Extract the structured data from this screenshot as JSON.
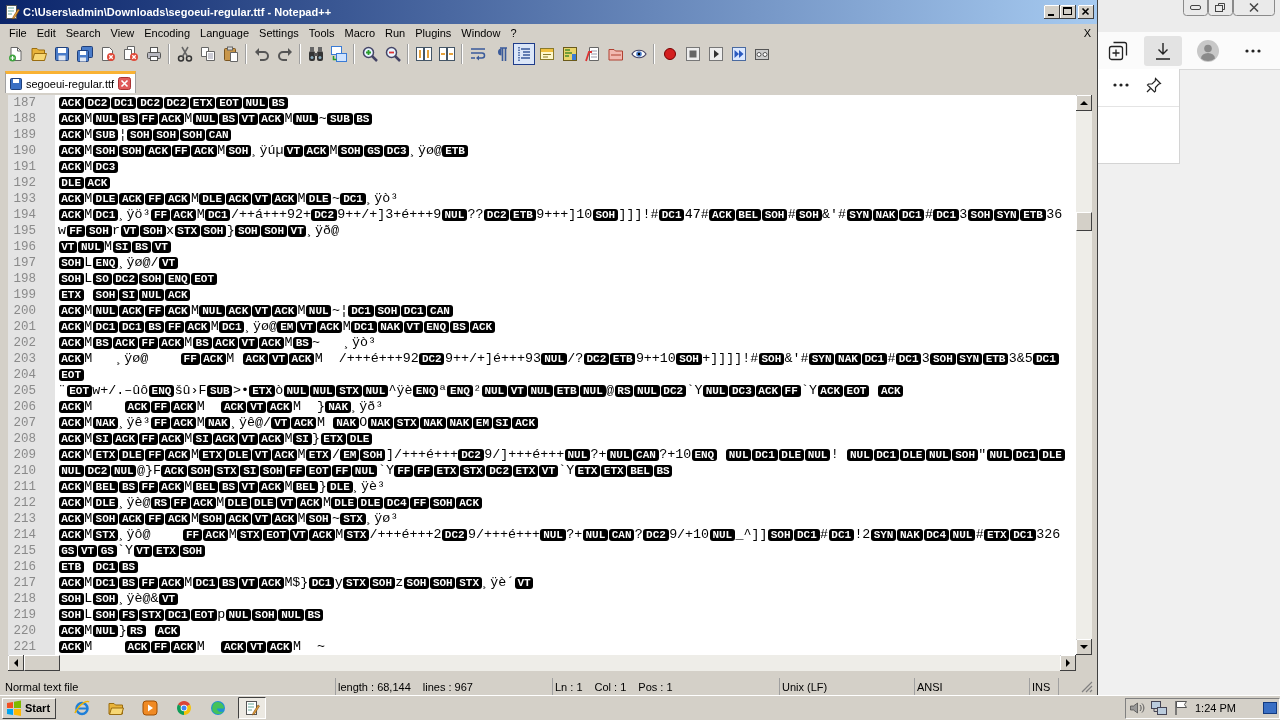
{
  "window": {
    "title": "C:\\Users\\admin\\Downloads\\segoeui-regular.ttf - Notepad++"
  },
  "menu": {
    "items": [
      "File",
      "Edit",
      "Search",
      "View",
      "Encoding",
      "Language",
      "Settings",
      "Tools",
      "Macro",
      "Run",
      "Plugins",
      "Window",
      "?"
    ],
    "close": "X"
  },
  "toolbar": {
    "groups": [
      {
        "buttons": [
          {
            "kind": "new",
            "pressed": false
          },
          {
            "kind": "open",
            "pressed": false
          },
          {
            "kind": "save",
            "pressed": false
          },
          {
            "kind": "saveall",
            "pressed": false
          },
          {
            "kind": "close",
            "pressed": false
          },
          {
            "kind": "closeall",
            "pressed": false
          },
          {
            "kind": "print",
            "pressed": false
          }
        ]
      },
      {
        "buttons": [
          {
            "kind": "cut",
            "pressed": false
          },
          {
            "kind": "copy",
            "pressed": false
          },
          {
            "kind": "paste",
            "pressed": false
          }
        ]
      },
      {
        "buttons": [
          {
            "kind": "undo",
            "pressed": false
          },
          {
            "kind": "redo",
            "pressed": false
          }
        ]
      },
      {
        "buttons": [
          {
            "kind": "find",
            "pressed": false
          },
          {
            "kind": "replace",
            "pressed": false
          }
        ]
      },
      {
        "buttons": [
          {
            "kind": "zoomin",
            "pressed": false
          },
          {
            "kind": "zoomout",
            "pressed": false
          }
        ]
      },
      {
        "buttons": [
          {
            "kind": "syncv",
            "pressed": false
          },
          {
            "kind": "synch",
            "pressed": false
          }
        ]
      },
      {
        "buttons": [
          {
            "kind": "wrap",
            "pressed": false
          },
          {
            "kind": "allchars",
            "pressed": false
          },
          {
            "kind": "indent",
            "pressed": true
          },
          {
            "kind": "udl",
            "pressed": false
          },
          {
            "kind": "docmap",
            "pressed": false
          },
          {
            "kind": "funclist",
            "pressed": false
          },
          {
            "kind": "workspace",
            "pressed": false
          },
          {
            "kind": "monitor",
            "pressed": false
          }
        ]
      },
      {
        "buttons": [
          {
            "kind": "record",
            "pressed": false
          },
          {
            "kind": "stop",
            "pressed": false
          },
          {
            "kind": "play",
            "pressed": false
          },
          {
            "kind": "playmulti",
            "pressed": false
          },
          {
            "kind": "savemacro",
            "pressed": false
          }
        ]
      }
    ]
  },
  "tabs": [
    {
      "label": "segoeui-regular.ttf",
      "selected": true,
      "modified": false
    }
  ],
  "editor": {
    "lines": [
      {
        "number": "187",
        "segments": [
          {
            "control": "ACK"
          },
          {
            "control": "DC2"
          },
          {
            "control": "DC1"
          },
          {
            "control": "DC2"
          },
          {
            "control": "DC2"
          },
          {
            "control": "ETX"
          },
          {
            "control": "EOT"
          },
          {
            "control": "NUL"
          },
          {
            "control": "BS"
          }
        ]
      },
      {
        "number": "188",
        "segments": [
          {
            "control": "ACK"
          },
          {
            "text": "M"
          },
          {
            "control": "NUL"
          },
          {
            "control": "BS"
          },
          {
            "control": "FF"
          },
          {
            "control": "ACK"
          },
          {
            "text": "M"
          },
          {
            "control": "NUL"
          },
          {
            "control": "BS"
          },
          {
            "control": "VT"
          },
          {
            "control": "ACK"
          },
          {
            "text": "M"
          },
          {
            "control": "NUL"
          },
          {
            "text": "~"
          },
          {
            "control": "SUB"
          },
          {
            "control": "BS"
          }
        ]
      },
      {
        "number": "189",
        "segments": [
          {
            "control": "ACK"
          },
          {
            "text": "M"
          },
          {
            "control": "SUB"
          },
          {
            "text": "¦"
          },
          {
            "control": "SOH"
          },
          {
            "control": "SOH"
          },
          {
            "control": "SOH"
          },
          {
            "control": "CAN"
          }
        ]
      },
      {
        "number": "190",
        "segments": [
          {
            "control": "ACK"
          },
          {
            "text": "M"
          },
          {
            "control": "SOH"
          },
          {
            "control": "SOH"
          },
          {
            "control": "ACK"
          },
          {
            "control": "FF"
          },
          {
            "control": "ACK"
          },
          {
            "text": "M"
          },
          {
            "control": "SOH"
          },
          {
            "text": "¸ÿúµ"
          },
          {
            "control": "VT"
          },
          {
            "control": "ACK"
          },
          {
            "text": "M"
          },
          {
            "control": "SOH"
          },
          {
            "control": "GS"
          },
          {
            "control": "DC3"
          },
          {
            "text": "¸ÿø@"
          },
          {
            "control": "ETB"
          }
        ]
      },
      {
        "number": "191",
        "segments": [
          {
            "control": "ACK"
          },
          {
            "text": "M"
          },
          {
            "control": "DC3"
          }
        ]
      },
      {
        "number": "192",
        "segments": [
          {
            "control": "DLE"
          },
          {
            "control": "ACK"
          }
        ]
      },
      {
        "number": "193",
        "segments": [
          {
            "control": "ACK"
          },
          {
            "text": "M"
          },
          {
            "control": "DLE"
          },
          {
            "control": "ACK"
          },
          {
            "control": "FF"
          },
          {
            "control": "ACK"
          },
          {
            "text": "M"
          },
          {
            "control": "DLE"
          },
          {
            "control": "ACK"
          },
          {
            "control": "VT"
          },
          {
            "control": "ACK"
          },
          {
            "text": "M"
          },
          {
            "control": "DLE"
          },
          {
            "text": "~"
          },
          {
            "control": "DC1"
          },
          {
            "text": "¸ÿò³"
          }
        ]
      },
      {
        "number": "194",
        "segments": [
          {
            "control": "ACK"
          },
          {
            "text": "M"
          },
          {
            "control": "DC1"
          },
          {
            "text": "¸ÿö³"
          },
          {
            "control": "FF"
          },
          {
            "control": "ACK"
          },
          {
            "text": "M"
          },
          {
            "control": "DC1"
          },
          {
            "text": "/++á+++92+"
          },
          {
            "control": "DC2"
          },
          {
            "text": "9++/+]3+é+++9"
          },
          {
            "control": "NUL"
          },
          {
            "text": "??"
          },
          {
            "control": "DC2"
          },
          {
            "control": "ETB"
          },
          {
            "text": "9+++]10"
          },
          {
            "control": "SOH"
          },
          {
            "text": "]]]!#"
          },
          {
            "control": "DC1"
          },
          {
            "text": "47#"
          },
          {
            "control": "ACK"
          },
          {
            "control": "BEL"
          },
          {
            "control": "SOH"
          },
          {
            "text": "#"
          },
          {
            "control": "SOH"
          },
          {
            "text": "&'#"
          },
          {
            "control": "SYN"
          },
          {
            "control": "NAK"
          },
          {
            "control": "DC1"
          },
          {
            "text": "#"
          },
          {
            "control": "DC1"
          },
          {
            "text": "3"
          },
          {
            "control": "SOH"
          },
          {
            "control": "SYN"
          },
          {
            "control": "ETB"
          },
          {
            "text": "36"
          }
        ]
      },
      {
        "number": "195",
        "segments": [
          {
            "text": "w"
          },
          {
            "control": "FF"
          },
          {
            "control": "SOH"
          },
          {
            "text": "r"
          },
          {
            "control": "VT"
          },
          {
            "control": "SOH"
          },
          {
            "text": "x"
          },
          {
            "control": "STX"
          },
          {
            "control": "SOH"
          },
          {
            "text": "}"
          },
          {
            "control": "SOH"
          },
          {
            "control": "SOH"
          },
          {
            "control": "VT"
          },
          {
            "text": "¸ÿð@"
          }
        ]
      },
      {
        "number": "196",
        "segments": [
          {
            "control": "VT"
          },
          {
            "control": "NUL"
          },
          {
            "text": "M"
          },
          {
            "control": "SI"
          },
          {
            "control": "BS"
          },
          {
            "control": "VT"
          }
        ]
      },
      {
        "number": "197",
        "segments": [
          {
            "control": "SOH"
          },
          {
            "text": "L"
          },
          {
            "control": "ENQ"
          },
          {
            "text": "¸ÿø@/"
          },
          {
            "control": "VT"
          }
        ]
      },
      {
        "number": "198",
        "segments": [
          {
            "control": "SOH"
          },
          {
            "text": "L"
          },
          {
            "control": "SO"
          },
          {
            "control": "DC2"
          },
          {
            "control": "SOH"
          },
          {
            "control": "ENQ"
          },
          {
            "control": "EOT"
          }
        ]
      },
      {
        "number": "199",
        "segments": [
          {
            "control": "ETX "
          },
          {
            "control": "SOH"
          },
          {
            "control": "SI"
          },
          {
            "control": "NUL"
          },
          {
            "control": "ACK"
          }
        ]
      },
      {
        "number": "200",
        "segments": [
          {
            "control": "ACK"
          },
          {
            "text": "M"
          },
          {
            "control": "NUL"
          },
          {
            "control": "ACK"
          },
          {
            "control": "FF"
          },
          {
            "control": "ACK"
          },
          {
            "text": "M"
          },
          {
            "control": "NUL"
          },
          {
            "control": "ACK"
          },
          {
            "control": "VT"
          },
          {
            "control": "ACK"
          },
          {
            "text": "M"
          },
          {
            "control": "NUL"
          },
          {
            "text": "~¦"
          },
          {
            "control": "DC1"
          },
          {
            "control": "SOH"
          },
          {
            "control": "DC1"
          },
          {
            "control": "CAN"
          }
        ]
      },
      {
        "number": "201",
        "segments": [
          {
            "control": "ACK"
          },
          {
            "text": "M"
          },
          {
            "control": "DC1"
          },
          {
            "control": "DC1"
          },
          {
            "control": "BS"
          },
          {
            "control": "FF"
          },
          {
            "control": "ACK"
          },
          {
            "text": "M"
          },
          {
            "control": "DC1"
          },
          {
            "text": "¸ÿø@"
          },
          {
            "control": "EM"
          },
          {
            "control": "VT"
          },
          {
            "control": "ACK"
          },
          {
            "text": "M"
          },
          {
            "control": "DC1"
          },
          {
            "control": "NAK"
          },
          {
            "control": "VT"
          },
          {
            "control": "ENQ"
          },
          {
            "control": "BS"
          },
          {
            "control": "ACK"
          }
        ]
      },
      {
        "number": "202",
        "segments": [
          {
            "control": "ACK"
          },
          {
            "text": "M"
          },
          {
            "control": "BS"
          },
          {
            "control": "ACK"
          },
          {
            "control": "FF"
          },
          {
            "control": "ACK"
          },
          {
            "text": "M"
          },
          {
            "control": "BS"
          },
          {
            "control": "ACK"
          },
          {
            "control": "VT"
          },
          {
            "control": "ACK"
          },
          {
            "text": "M"
          },
          {
            "control": "BS"
          },
          {
            "text": "~   ¸ÿò³"
          }
        ]
      },
      {
        "number": "203",
        "segments": [
          {
            "control": "ACK"
          },
          {
            "text": "M   ¸ÿø@    "
          },
          {
            "control": "FF"
          },
          {
            "control": "ACK"
          },
          {
            "text": "M "
          },
          {
            "control": "ACK"
          },
          {
            "control": "VT"
          },
          {
            "control": "ACK"
          },
          {
            "text": "M  /+++é+++92"
          },
          {
            "control": "DC2"
          },
          {
            "text": "9++/+]é+++93"
          },
          {
            "control": "NUL"
          },
          {
            "text": "/?"
          },
          {
            "control": "DC2"
          },
          {
            "control": "ETB"
          },
          {
            "text": "9++10"
          },
          {
            "control": "SOH"
          },
          {
            "text": "+]]]]!#"
          },
          {
            "control": "SOH"
          },
          {
            "text": "&'#"
          },
          {
            "control": "SYN"
          },
          {
            "control": "NAK"
          },
          {
            "control": "DC1"
          },
          {
            "text": "#"
          },
          {
            "control": "DC1"
          },
          {
            "text": "3"
          },
          {
            "control": "SOH"
          },
          {
            "control": "SYN"
          },
          {
            "control": "ETB"
          },
          {
            "text": "3&5"
          },
          {
            "control": "DC1"
          }
        ]
      },
      {
        "number": "204",
        "segments": [
          {
            "control": "EOT"
          }
        ]
      },
      {
        "number": "205",
        "segments": [
          {
            "text": "¨"
          },
          {
            "control": "EOT"
          },
          {
            "text": "w+/.–ûô"
          },
          {
            "control": "ENQ"
          },
          {
            "text": "šû›F"
          },
          {
            "control": "SUB"
          },
          {
            "text": ">•"
          },
          {
            "control": "ETX"
          },
          {
            "text": "ò"
          },
          {
            "control": "NUL"
          },
          {
            "control": "NUL"
          },
          {
            "control": "STX"
          },
          {
            "control": "NUL"
          },
          {
            "text": "^ÿè"
          },
          {
            "control": "ENQ"
          },
          {
            "text": "ª"
          },
          {
            "control": "ENQ"
          },
          {
            "text": "²"
          },
          {
            "control": "NUL"
          },
          {
            "control": "VT"
          },
          {
            "control": "NUL"
          },
          {
            "control": "ETB"
          },
          {
            "control": "NUL"
          },
          {
            "text": "@"
          },
          {
            "control": "RS"
          },
          {
            "control": "NUL"
          },
          {
            "control": "DC2"
          },
          {
            "text": "`Y"
          },
          {
            "control": "NUL"
          },
          {
            "control": "DC3"
          },
          {
            "control": "ACK"
          },
          {
            "control": "FF"
          },
          {
            "text": "`Y"
          },
          {
            "control": "ACK"
          },
          {
            "control": "EOT "
          },
          {
            "control": "ACK"
          }
        ]
      },
      {
        "number": "206",
        "segments": [
          {
            "control": "ACK"
          },
          {
            "text": "M    "
          },
          {
            "control": "ACK"
          },
          {
            "control": "FF"
          },
          {
            "control": "ACK"
          },
          {
            "text": "M  "
          },
          {
            "control": "ACK"
          },
          {
            "control": "VT"
          },
          {
            "control": "ACK"
          },
          {
            "text": "M  }"
          },
          {
            "control": "NAK"
          },
          {
            "text": "¸ÿð³"
          }
        ]
      },
      {
        "number": "207",
        "segments": [
          {
            "control": "ACK"
          },
          {
            "text": "M"
          },
          {
            "control": "NAK"
          },
          {
            "text": "¸ÿê³"
          },
          {
            "control": "FF"
          },
          {
            "control": "ACK"
          },
          {
            "text": "M"
          },
          {
            "control": "NAK"
          },
          {
            "text": "¸ÿê@/"
          },
          {
            "control": "VT"
          },
          {
            "control": "ACK"
          },
          {
            "text": "M "
          },
          {
            "control": "NAK"
          },
          {
            "text": "O"
          },
          {
            "control": "NAK"
          },
          {
            "control": "STX"
          },
          {
            "control": "NAK"
          },
          {
            "control": "NAK"
          },
          {
            "control": "EM"
          },
          {
            "control": "SI"
          },
          {
            "control": "ACK"
          }
        ]
      },
      {
        "number": "208",
        "segments": [
          {
            "control": "ACK"
          },
          {
            "text": "M"
          },
          {
            "control": "SI"
          },
          {
            "control": "ACK"
          },
          {
            "control": "FF"
          },
          {
            "control": "ACK"
          },
          {
            "text": "M"
          },
          {
            "control": "SI"
          },
          {
            "control": "ACK"
          },
          {
            "control": "VT"
          },
          {
            "control": "ACK"
          },
          {
            "text": "M"
          },
          {
            "control": "SI"
          },
          {
            "text": "}"
          },
          {
            "control": "ETX"
          },
          {
            "control": "DLE"
          }
        ]
      },
      {
        "number": "209",
        "segments": [
          {
            "control": "ACK"
          },
          {
            "text": "M"
          },
          {
            "control": "ETX"
          },
          {
            "control": "DLE"
          },
          {
            "control": "FF"
          },
          {
            "control": "ACK"
          },
          {
            "text": "M"
          },
          {
            "control": "ETX"
          },
          {
            "control": "DLE"
          },
          {
            "control": "VT"
          },
          {
            "control": "ACK"
          },
          {
            "text": "M"
          },
          {
            "control": "ETX"
          },
          {
            "text": "/"
          },
          {
            "control": "EM"
          },
          {
            "control": "SOH"
          },
          {
            "text": "]/+++é+++"
          },
          {
            "control": "DC2"
          },
          {
            "text": "9/]+++é+++"
          },
          {
            "control": "NUL"
          },
          {
            "text": "?+"
          },
          {
            "control": "NUL"
          },
          {
            "control": "CAN"
          },
          {
            "text": "?+10"
          },
          {
            "control": "ENQ "
          },
          {
            "control": "NUL"
          },
          {
            "control": "DC1"
          },
          {
            "control": "DLE"
          },
          {
            "control": "NUL"
          },
          {
            "text": "! "
          },
          {
            "control": "NUL"
          },
          {
            "control": "DC1"
          },
          {
            "control": "DLE"
          },
          {
            "control": "NUL"
          },
          {
            "control": "SOH"
          },
          {
            "text": "\""
          },
          {
            "control": "NUL"
          },
          {
            "control": "DC1"
          },
          {
            "control": "DLE"
          }
        ]
      },
      {
        "number": "210",
        "segments": [
          {
            "control": "NUL"
          },
          {
            "control": "DC2"
          },
          {
            "control": "NUL"
          },
          {
            "text": "@}F"
          },
          {
            "control": "ACK"
          },
          {
            "control": "SOH"
          },
          {
            "control": "STX"
          },
          {
            "control": "SI"
          },
          {
            "control": "SOH"
          },
          {
            "control": "FF"
          },
          {
            "control": "EOT"
          },
          {
            "control": "FF"
          },
          {
            "control": "NUL"
          },
          {
            "text": "`Y"
          },
          {
            "control": "FF"
          },
          {
            "control": "FF"
          },
          {
            "control": "ETX"
          },
          {
            "control": "STX"
          },
          {
            "control": "DC2"
          },
          {
            "control": "ETX"
          },
          {
            "control": "VT"
          },
          {
            "text": "`Y"
          },
          {
            "control": "ETX"
          },
          {
            "control": "ETX"
          },
          {
            "control": "BEL"
          },
          {
            "control": "BS"
          }
        ]
      },
      {
        "number": "211",
        "segments": [
          {
            "control": "ACK"
          },
          {
            "text": "M"
          },
          {
            "control": "BEL"
          },
          {
            "control": "BS"
          },
          {
            "control": "FF"
          },
          {
            "control": "ACK"
          },
          {
            "text": "M"
          },
          {
            "control": "BEL"
          },
          {
            "control": "BS"
          },
          {
            "control": "VT"
          },
          {
            "control": "ACK"
          },
          {
            "text": "M"
          },
          {
            "control": "BEL"
          },
          {
            "text": "}"
          },
          {
            "control": "DLE"
          },
          {
            "text": "¸ÿè³"
          }
        ]
      },
      {
        "number": "212",
        "segments": [
          {
            "control": "ACK"
          },
          {
            "text": "M"
          },
          {
            "control": "DLE"
          },
          {
            "text": "¸ÿè@"
          },
          {
            "control": "RS"
          },
          {
            "control": "FF"
          },
          {
            "control": "ACK"
          },
          {
            "text": "M"
          },
          {
            "control": "DLE"
          },
          {
            "control": "DLE"
          },
          {
            "control": "VT"
          },
          {
            "control": "ACK"
          },
          {
            "text": "M"
          },
          {
            "control": "DLE"
          },
          {
            "control": "DLE"
          },
          {
            "control": "DC4"
          },
          {
            "control": "FF"
          },
          {
            "control": "SOH"
          },
          {
            "control": "ACK"
          }
        ]
      },
      {
        "number": "213",
        "segments": [
          {
            "control": "ACK"
          },
          {
            "text": "M"
          },
          {
            "control": "SOH"
          },
          {
            "control": "ACK"
          },
          {
            "control": "FF"
          },
          {
            "control": "ACK"
          },
          {
            "text": "M"
          },
          {
            "control": "SOH"
          },
          {
            "control": "ACK"
          },
          {
            "control": "VT"
          },
          {
            "control": "ACK"
          },
          {
            "text": "M"
          },
          {
            "control": "SOH"
          },
          {
            "text": "~"
          },
          {
            "control": "STX"
          },
          {
            "text": "¸ÿø³"
          }
        ]
      },
      {
        "number": "214",
        "segments": [
          {
            "control": "ACK"
          },
          {
            "text": "M"
          },
          {
            "control": "STX"
          },
          {
            "text": "¸ÿô@    "
          },
          {
            "control": "FF"
          },
          {
            "control": "ACK"
          },
          {
            "text": "M"
          },
          {
            "control": "STX"
          },
          {
            "control": "EOT"
          },
          {
            "control": "VT"
          },
          {
            "control": "ACK"
          },
          {
            "text": "M"
          },
          {
            "control": "STX"
          },
          {
            "text": "/+++é+++2"
          },
          {
            "control": "DC2"
          },
          {
            "text": "9/+++é+++"
          },
          {
            "control": "NUL"
          },
          {
            "text": "?+"
          },
          {
            "control": "NUL"
          },
          {
            "control": "CAN"
          },
          {
            "text": "?"
          },
          {
            "control": "DC2"
          },
          {
            "text": "9/+10"
          },
          {
            "control": "NUL"
          },
          {
            "text": "_^]]"
          },
          {
            "control": "SOH"
          },
          {
            "control": "DC1"
          },
          {
            "text": "#"
          },
          {
            "control": "DC1"
          },
          {
            "text": "!2"
          },
          {
            "control": "SYN"
          },
          {
            "control": "NAK"
          },
          {
            "control": "DC4"
          },
          {
            "control": "NUL"
          },
          {
            "text": "#"
          },
          {
            "control": "ETX"
          },
          {
            "control": "DC1"
          },
          {
            "text": "326"
          }
        ]
      },
      {
        "number": "215",
        "segments": [
          {
            "control": "GS"
          },
          {
            "control": "VT"
          },
          {
            "control": "GS"
          },
          {
            "text": "`Y"
          },
          {
            "control": "VT"
          },
          {
            "control": "ETX"
          },
          {
            "control": "SOH"
          }
        ]
      },
      {
        "number": "216",
        "segments": [
          {
            "control": "ETB "
          },
          {
            "control": "DC1"
          },
          {
            "control": "BS"
          }
        ]
      },
      {
        "number": "217",
        "segments": [
          {
            "control": "ACK"
          },
          {
            "text": "M"
          },
          {
            "control": "DC1"
          },
          {
            "control": "BS"
          },
          {
            "control": "FF"
          },
          {
            "control": "ACK"
          },
          {
            "text": "M"
          },
          {
            "control": "DC1"
          },
          {
            "control": "BS"
          },
          {
            "control": "VT"
          },
          {
            "control": "ACK"
          },
          {
            "text": "M$}"
          },
          {
            "control": "DC1"
          },
          {
            "text": "y"
          },
          {
            "control": "STX"
          },
          {
            "control": "SOH"
          },
          {
            "text": "z"
          },
          {
            "control": "SOH"
          },
          {
            "control": "SOH"
          },
          {
            "control": "STX"
          },
          {
            "text": "¸ÿè´"
          },
          {
            "control": "VT"
          }
        ]
      },
      {
        "number": "218",
        "segments": [
          {
            "control": "SOH"
          },
          {
            "text": "L"
          },
          {
            "control": "SOH"
          },
          {
            "text": "¸ÿè@&"
          },
          {
            "control": "VT"
          }
        ]
      },
      {
        "number": "219",
        "segments": [
          {
            "control": "SOH"
          },
          {
            "text": "L"
          },
          {
            "control": "SOH"
          },
          {
            "control": "FS"
          },
          {
            "control": "STX"
          },
          {
            "control": "DC1"
          },
          {
            "control": "EOT"
          },
          {
            "text": "p"
          },
          {
            "control": "NUL"
          },
          {
            "control": "SOH"
          },
          {
            "control": "NUL"
          },
          {
            "control": "BS"
          }
        ]
      },
      {
        "number": "220",
        "segments": [
          {
            "control": "ACK"
          },
          {
            "text": "M"
          },
          {
            "control": "NUL"
          },
          {
            "text": "}"
          },
          {
            "control": "RS "
          },
          {
            "control": "ACK"
          }
        ]
      },
      {
        "number": "221",
        "segments": [
          {
            "control": "ACK"
          },
          {
            "text": "M    "
          },
          {
            "control": "ACK"
          },
          {
            "control": "FF"
          },
          {
            "control": "ACK"
          },
          {
            "text": "M  "
          },
          {
            "control": "ACK"
          },
          {
            "control": "VT"
          },
          {
            "control": "ACK"
          },
          {
            "text": "M  ~"
          }
        ]
      }
    ]
  },
  "status_bar": [
    {
      "texts": [
        "Normal text file"
      ]
    },
    {
      "texts": [
        "length : 68,144",
        "lines : 967"
      ]
    },
    {
      "texts": [
        "Ln : 1",
        "Col : 1",
        "Pos : 1"
      ]
    },
    {
      "texts": [
        "Unix (LF)"
      ]
    },
    {
      "texts": [
        "ANSI"
      ]
    },
    {
      "texts": [
        "INS"
      ]
    }
  ],
  "browser_sidebar": {
    "toolbar": [
      {
        "kind": "collections",
        "active": false
      },
      {
        "kind": "download",
        "active": true
      },
      {
        "kind": "profile",
        "active": false
      },
      {
        "kind": "more",
        "active": false
      }
    ],
    "flyout": [
      {
        "kind": "more"
      },
      {
        "kind": "pin"
      }
    ]
  },
  "taskbar": {
    "start": "Start",
    "apps": [
      {
        "kind": "ie",
        "active": false
      },
      {
        "kind": "explorer",
        "active": false
      },
      {
        "kind": "player",
        "active": false
      },
      {
        "kind": "chrome",
        "active": false
      },
      {
        "kind": "edge",
        "active": false
      },
      {
        "kind": "notepad",
        "active": true
      }
    ],
    "tray": [
      {
        "kind": "volume"
      },
      {
        "kind": "network"
      },
      {
        "kind": "flag"
      }
    ],
    "clock": "1:24 PM"
  }
}
